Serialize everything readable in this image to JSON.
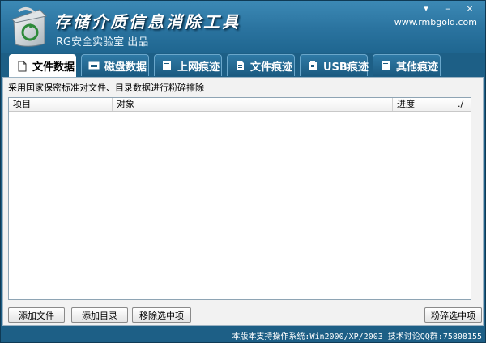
{
  "app": {
    "title": "存储介质信息消除工具",
    "subtitle": "RG安全实验室 出品",
    "site": "www.rmbgold.com",
    "controls": {
      "menu": "▾",
      "minimize": "–",
      "close": "×"
    }
  },
  "tabs": [
    {
      "label": "文件数据",
      "icon": "document-icon",
      "active": true
    },
    {
      "label": "磁盘数据",
      "icon": "disk-icon",
      "active": false
    },
    {
      "label": "上网痕迹",
      "icon": "browser-icon",
      "active": false
    },
    {
      "label": "文件痕迹",
      "icon": "file-trace-icon",
      "active": false
    },
    {
      "label": "USB痕迹",
      "icon": "usb-icon",
      "active": false
    },
    {
      "label": "其他痕迹",
      "icon": "other-trace-icon",
      "active": false
    }
  ],
  "main": {
    "description": "采用国家保密标准对文件、目录数据进行粉碎擦除",
    "columns": {
      "item": "项目",
      "object": "对象",
      "progress": "进度",
      "check": "./"
    },
    "rows": [],
    "buttons": {
      "add_file": "添加文件",
      "add_dir": "添加目录",
      "remove_selected": "移除选中项",
      "shred_selected": "粉碎选中项"
    }
  },
  "status": {
    "text": "本版本支持操作系统:Win2000/XP/2003   技术讨论QQ群:75808155"
  },
  "colors": {
    "frame": "#1d5f86",
    "title_bar": "#2a739f",
    "panel": "#f2f2f2"
  }
}
